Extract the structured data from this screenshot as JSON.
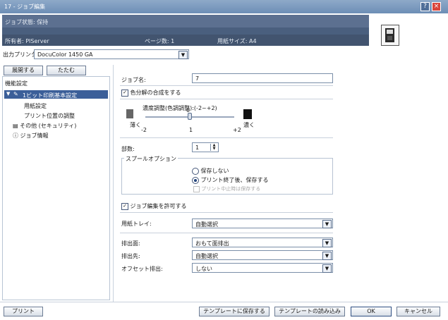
{
  "window": {
    "title": "17 - ジョブ編集",
    "help_label": "?",
    "close_label": "×"
  },
  "info": {
    "status": "ジョブ状態: 保持",
    "owner": "所有者: PIServer",
    "pages": "ページ数: 1",
    "paper_size": "用紙サイズ: A4"
  },
  "printer": {
    "label": "出力プリンタ:",
    "value": "DocuColor 1450 GA"
  },
  "tree_buttons": {
    "expand": "展開する",
    "collapse": "たたむ"
  },
  "tree": {
    "items": [
      {
        "label": "機能設定"
      },
      {
        "label": "1ビット印刷基本設定"
      },
      {
        "label": "用紙設定"
      },
      {
        "label": "プリント位置の調整"
      },
      {
        "label": "その他 (セキュリティ)"
      },
      {
        "label": "ジョブ情報"
      }
    ]
  },
  "form": {
    "job_name_label": "ジョブ名:",
    "job_name_value": "7",
    "color_separation_label": "色分解の合成をする",
    "color_separation_checked": true,
    "density_label": "濃度調整(色調調整):(-2~+2)",
    "density_light": "薄く",
    "density_dark": "濃く",
    "density_value": "0",
    "density_ticks": [
      "-2",
      "1",
      "+2"
    ],
    "copies_label": "部数:",
    "copies_value": "1",
    "spool_label": "スプールオプション",
    "spool_options": [
      {
        "label": "保存しない",
        "selected": false
      },
      {
        "label": "プリント終了後、保存する",
        "selected": true
      },
      {
        "label": "プリント中止時は保存する",
        "selected": false
      }
    ],
    "job_edit_label": "ジョブ編集を許可する",
    "job_edit_checked": true,
    "paper_tray_label": "用紙トレイ:",
    "paper_tray_value": "自動選択",
    "output_side_label": "排出面:",
    "output_side_value": "おもて面排出",
    "output_dest_label": "排出先:",
    "output_dest_value": "自動選択",
    "offset_label": "オフセット排出:",
    "offset_value": "しない"
  },
  "footer": {
    "print": "プリント",
    "save_template": "テンプレートに保存する",
    "load_template": "テンプレートの読み込み",
    "ok": "OK",
    "cancel": "キャンセル"
  }
}
